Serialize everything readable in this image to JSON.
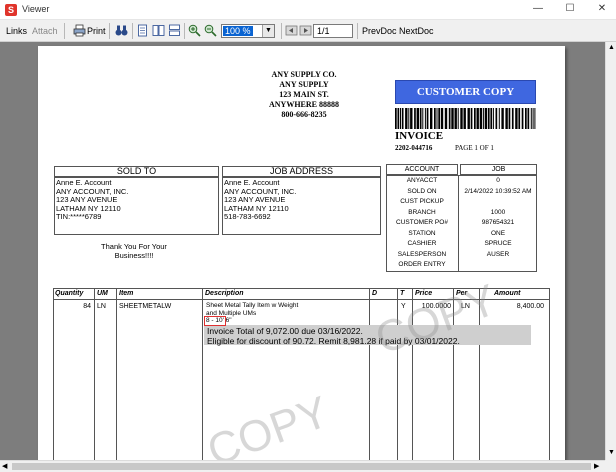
{
  "window": {
    "title": "Viewer",
    "app_icon": "S",
    "minimize": "—",
    "maximize": "☐",
    "close": "✕"
  },
  "toolbar": {
    "links": "Links",
    "attach": "Attach",
    "print": "Print",
    "zoom": "100 %",
    "page": "1/1",
    "prevdoc": "PrevDoc",
    "nextdoc": "NextDoc",
    "icons": [
      "printer-icon",
      "binoculars-icon",
      "single-page-icon",
      "two-page-icon",
      "multi-page-icon",
      "zoom-in-icon",
      "zoom-out-icon",
      "first-page-icon",
      "last-page-icon"
    ]
  },
  "invoice": {
    "company": [
      "ANY SUPPLY CO.",
      "ANY SUPPLY",
      "123 MAIN ST.",
      "ANYWHERE 88888",
      "800-666-8235"
    ],
    "customer_copy": "CUSTOMER COPY",
    "title": "INVOICE",
    "number": "2202-044716",
    "page_text": "PAGE    1    OF    1",
    "sold_to": {
      "title": "SOLD TO",
      "lines": [
        "Anne E. Account",
        "ANY ACCOUNT, INC.",
        "123 ANY AVENUE",
        "LATHAM NY 12110",
        "TIN:*****6789"
      ]
    },
    "job_address": {
      "title": "JOB ADDRESS",
      "lines": [
        "Anne E. Account",
        "ANY ACCOUNT, INC.",
        "123 ANY AVENUE",
        "LATHAM NY 12110",
        "518-783-6692"
      ]
    },
    "thanks": [
      "Thank You For Your",
      "Business!!!!"
    ],
    "account_header": {
      "account": "ACCOUNT",
      "job": "JOB"
    },
    "account_rows": [
      {
        "label": "ANYACCT",
        "value": "0"
      },
      {
        "label": "SOLD ON",
        "value": "2/14/2022 10:39:52 AM"
      },
      {
        "label": "CUST PICKUP",
        "value": ""
      },
      {
        "label": "BRANCH",
        "value": "1000"
      },
      {
        "label": "CUSTOMER PO#",
        "value": "987654321"
      },
      {
        "label": "STATION",
        "value": "ONE"
      },
      {
        "label": "CASHIER",
        "value": "SPRUCE"
      },
      {
        "label": "SALESPERSON",
        "value": "AUSER"
      },
      {
        "label": "ORDER ENTRY",
        "value": ""
      }
    ],
    "columns": [
      "Quantity",
      "UM",
      "Item",
      "Description",
      "D",
      "T",
      "Price",
      "Per",
      "Amount"
    ],
    "line_item": {
      "quantity": "84",
      "um": "LN",
      "item": "SHEETMETALW",
      "desc1": "Sheet Metal Tally Item w Weight",
      "desc2": "and Multiple UMs",
      "desc3_prefix": "8 - ",
      "desc3_highlight": "10' 6\"",
      "t": "Y",
      "price": "100.0000",
      "per": "LN",
      "amount": "8,400.00"
    },
    "totals_line1": "Invoice Total of 9,072.00 due 03/16/2022.",
    "totals_line2": "Eligible for discount of 90.72. Remit 8,981.28 if paid by 03/01/2022.",
    "watermark": "COPY",
    "colors": {
      "customer_copy_bg": "#3f67e0",
      "highlight_border": "#e03030",
      "viewer_bg": "#7d7d7d"
    }
  }
}
